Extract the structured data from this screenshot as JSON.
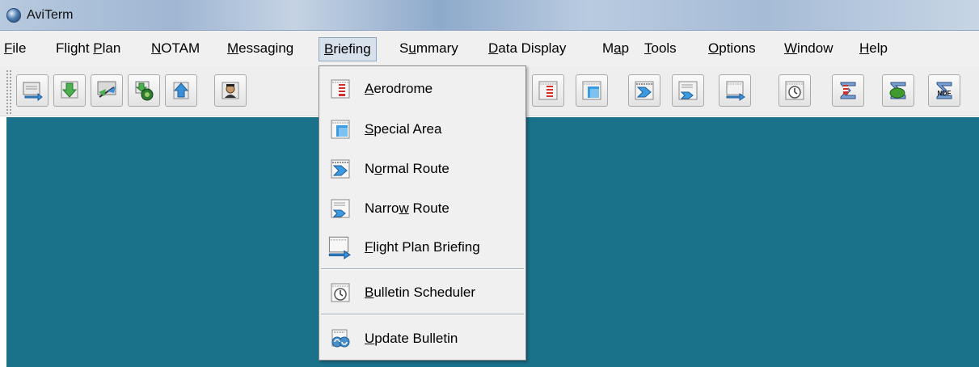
{
  "window": {
    "title": "AviTerm",
    "desktop_color": "#19718a"
  },
  "menubar": {
    "items": [
      {
        "id": "file",
        "label": "File"
      },
      {
        "id": "flight-plan",
        "label": "Flight Plan"
      },
      {
        "id": "notam",
        "label": "NOTAM"
      },
      {
        "id": "messaging",
        "label": "Messaging"
      },
      {
        "id": "briefing",
        "label": "Briefing",
        "open": true
      },
      {
        "id": "summary",
        "label": "Summary"
      },
      {
        "id": "data-display",
        "label": "Data Display"
      },
      {
        "id": "map",
        "label": "Map"
      },
      {
        "id": "tools",
        "label": "Tools"
      },
      {
        "id": "options",
        "label": "Options"
      },
      {
        "id": "window",
        "label": "Window"
      },
      {
        "id": "help",
        "label": "Help"
      }
    ]
  },
  "toolbar": {
    "buttons": [
      {
        "icon": "send-flight-plan-icon"
      },
      {
        "icon": "download-icon"
      },
      {
        "icon": "message-exchange-icon"
      },
      {
        "icon": "receive-messages-icon"
      },
      {
        "icon": "upload-icon"
      },
      {
        "icon": "operator-icon"
      },
      {
        "icon": "aerodrome-briefing-icon"
      },
      {
        "icon": "special-area-icon"
      },
      {
        "icon": "normal-route-icon"
      },
      {
        "icon": "narrow-route-icon"
      },
      {
        "icon": "flight-plan-briefing-icon"
      },
      {
        "icon": "bulletin-scheduler-icon"
      },
      {
        "icon": "aerodrome-summary-icon"
      },
      {
        "icon": "area-summary-icon"
      },
      {
        "icon": "nof-summary-icon"
      }
    ],
    "nof_label": "NOF"
  },
  "briefing_menu": {
    "items": [
      {
        "label": "Aerodrome",
        "icon": "aerodrome-icon"
      },
      {
        "label": "Special Area",
        "icon": "special-area-icon"
      },
      {
        "label": "Normal Route",
        "icon": "normal-route-icon"
      },
      {
        "label": "Narrow Route",
        "icon": "narrow-route-icon"
      },
      {
        "label": "Flight Plan Briefing",
        "icon": "flight-plan-briefing-icon"
      },
      {
        "label": "Bulletin Scheduler",
        "icon": "stopwatch-icon"
      },
      {
        "label": "Update Bulletin",
        "icon": "update-bulletin-icon"
      }
    ]
  }
}
